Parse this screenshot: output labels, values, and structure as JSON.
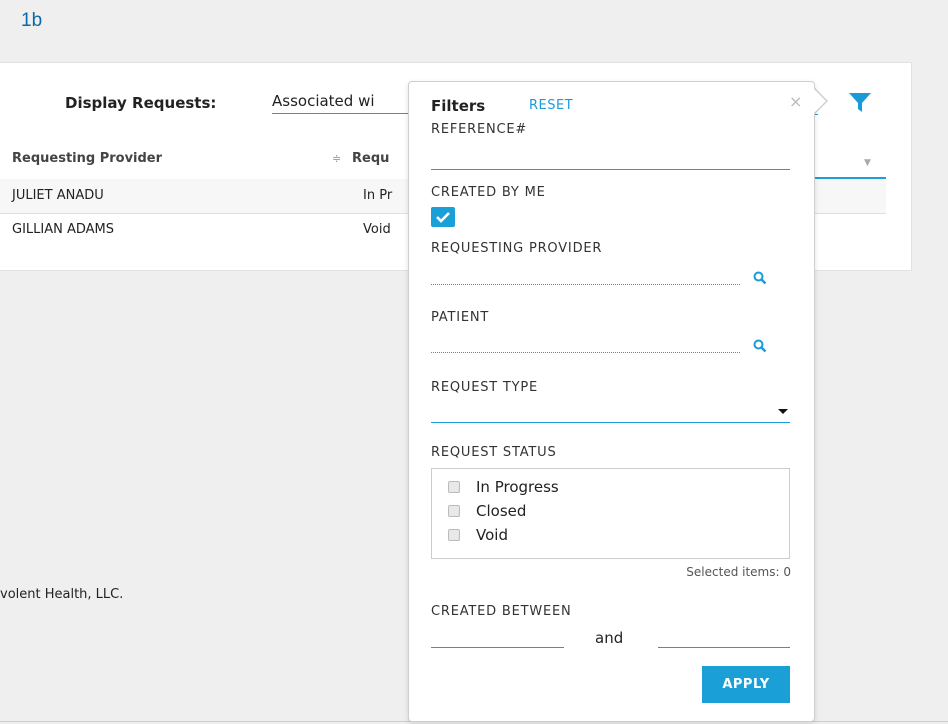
{
  "page_label": "1b",
  "header": {
    "display_requests_label": "Display Requests:",
    "display_requests_value": "Associated wi"
  },
  "table": {
    "columns": [
      "Requesting Provider",
      "Requ"
    ],
    "rows": [
      {
        "provider": "JULIET ANADU",
        "status": "In Pr"
      },
      {
        "provider": "GILLIAN ADAMS",
        "status": "Void"
      }
    ]
  },
  "footer": {
    "text": "volent Health, LLC."
  },
  "filters": {
    "title": "Filters",
    "reset_label": "RESET",
    "close_symbol": "×",
    "reference_label": "REFERENCE#",
    "created_by_me_label": "CREATED BY ME",
    "created_by_me_checked": true,
    "requesting_provider_label": "REQUESTING PROVIDER",
    "patient_label": "PATIENT",
    "request_type_label": "REQUEST TYPE",
    "request_status_label": "REQUEST STATUS",
    "status_options": [
      "In Progress",
      "Closed",
      "Void"
    ],
    "selected_items_text": "Selected items: 0",
    "created_between_label": "CREATED BETWEEN",
    "and_label": "and",
    "apply_label": "APPLY"
  },
  "colors": {
    "accent": "#1aa0d6",
    "page_label": "#0a6aa8"
  }
}
